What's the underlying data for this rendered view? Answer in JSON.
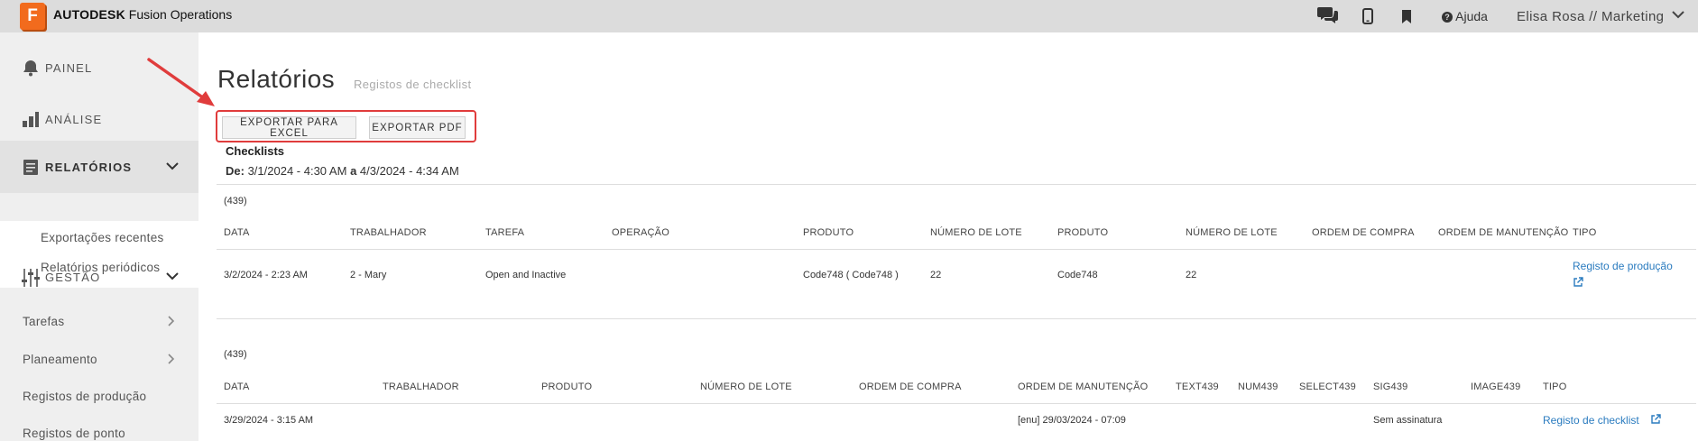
{
  "topbar": {
    "logo_letter": "F",
    "brand_bold": "AUTODESK",
    "brand_rest": "Fusion Operations",
    "help_label": "Ajuda",
    "user_label": "Elisa Rosa // Marketing"
  },
  "sidebar": {
    "items": [
      {
        "label": "PAINEL"
      },
      {
        "label": "ANÁLISE"
      },
      {
        "label": "RELATÓRIOS"
      },
      {
        "label": "GESTÃO"
      }
    ],
    "reports_sub": [
      "Exportações recentes",
      "Relatórios periódicos"
    ],
    "links": [
      "Tarefas",
      "Planeamento",
      "Registos de produção",
      "Registos de ponto"
    ]
  },
  "page": {
    "title": "Relatórios",
    "subtitle": "Registos de checklist",
    "export_excel": "EXPORTAR PARA EXCEL",
    "export_pdf": "EXPORTAR PDF",
    "section_label": "Checklists",
    "range_from_label": "De:",
    "range_from": "3/1/2024 - 4:30 AM",
    "range_to_label": "a",
    "range_to": "4/3/2024 - 4:34 AM"
  },
  "table1": {
    "count": "(439)",
    "headers": [
      "DATA",
      "TRABALHADOR",
      "TAREFA",
      "OPERAÇÃO",
      "PRODUTO",
      "NÚMERO DE LOTE",
      "PRODUTO",
      "NÚMERO DE LOTE",
      "ORDEM DE COMPRA",
      "ORDEM DE MANUTENÇÃO",
      "TIPO"
    ],
    "row": [
      "3/2/2024 - 2:23 AM",
      "2 - Mary",
      "Open and Inactive",
      "",
      "Code748 ( Code748 )",
      "22",
      "Code748",
      "22",
      "",
      ""
    ],
    "link": "Registo de produção"
  },
  "table2": {
    "count": "(439)",
    "headers": [
      "DATA",
      "TRABALHADOR",
      "PRODUTO",
      "NÚMERO DE LOTE",
      "ORDEM DE COMPRA",
      "ORDEM DE MANUTENÇÃO",
      "TEXT439",
      "NUM439",
      "SELECT439",
      "SIG439",
      "IMAGE439",
      "TIPO"
    ],
    "row": [
      "3/29/2024 - 3:15 AM",
      "",
      "",
      "",
      "",
      "[enu] 29/03/2024 - 07:09",
      "",
      "",
      "",
      "Sem assinatura",
      ""
    ],
    "link": "Registo de checklist"
  },
  "colors": {
    "accent_orange": "#f26b1d",
    "annotation_red": "#e03c3c",
    "link_blue": "#2a7bbf"
  }
}
